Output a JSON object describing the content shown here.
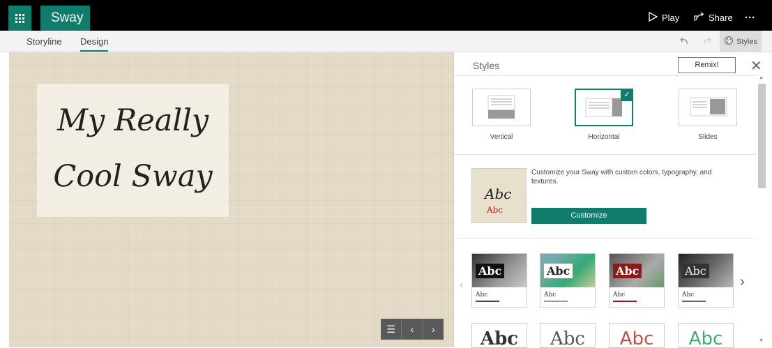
{
  "app": {
    "name": "Sway"
  },
  "topbar": {
    "play_label": "Play",
    "share_label": "Share",
    "more_label": "···"
  },
  "tabs": {
    "storyline": "Storyline",
    "design": "Design"
  },
  "toolbar": {
    "styles_label": "Styles"
  },
  "canvas": {
    "title_line1": "My Really",
    "title_line2": "Cool Sway"
  },
  "panel": {
    "title": "Styles",
    "remix_label": "Remix!",
    "layouts": [
      {
        "label": "Vertical"
      },
      {
        "label": "Horizontal",
        "selected": true
      },
      {
        "label": "Slides"
      }
    ],
    "customize_text": "Customize your Sway with custom colors, typography, and textures.",
    "customize_label": "Customize",
    "preview_big": "Abc",
    "preview_small": "Abc",
    "themes": [
      {
        "head": "Abc",
        "small": "Abc"
      },
      {
        "head": "Abc",
        "small": "Abc"
      },
      {
        "head": "Abc",
        "small": "Abc"
      },
      {
        "head": "Abc",
        "small": "Abc"
      }
    ],
    "themes_row2": [
      "Abc",
      "Abc",
      "Abc",
      "Abc"
    ]
  },
  "colors": {
    "accent": "#107c6c"
  }
}
